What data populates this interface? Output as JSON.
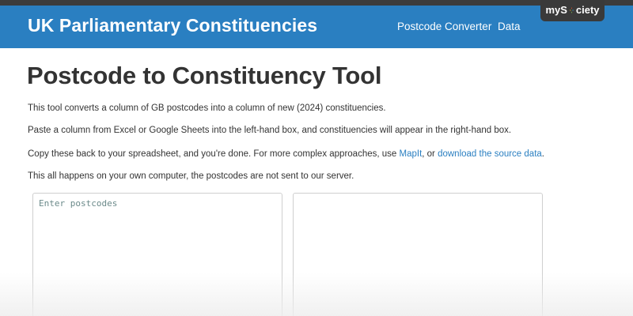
{
  "header": {
    "site_title": "UK Parliamentary Constituencies",
    "nav": [
      "Postcode Converter",
      "Data"
    ],
    "brand_before": "myS",
    "brand_after": "ciety",
    "brand_logo_icon": "mysociety-o-icon",
    "accent_color": "#2a7fc1"
  },
  "main": {
    "title": "Postcode to Constituency Tool",
    "p1": "This tool converts a column of GB postcodes into a column of new (2024) constituencies.",
    "p2": "Paste a column from Excel or Google Sheets into the left-hand box, and constituencies will appear in the right-hand box.",
    "p3_before": "Copy these back to your spreadsheet, and you're done. For more complex approaches, use ",
    "p3_link1": "MapIt",
    "p3_mid": ", or ",
    "p3_link2": "download the source data",
    "p3_after": ".",
    "p4": "This all happens on your own computer, the postcodes are not sent to our server."
  },
  "input_box": {
    "placeholder": "Enter postcodes",
    "value": ""
  },
  "output_box": {
    "value": ""
  }
}
